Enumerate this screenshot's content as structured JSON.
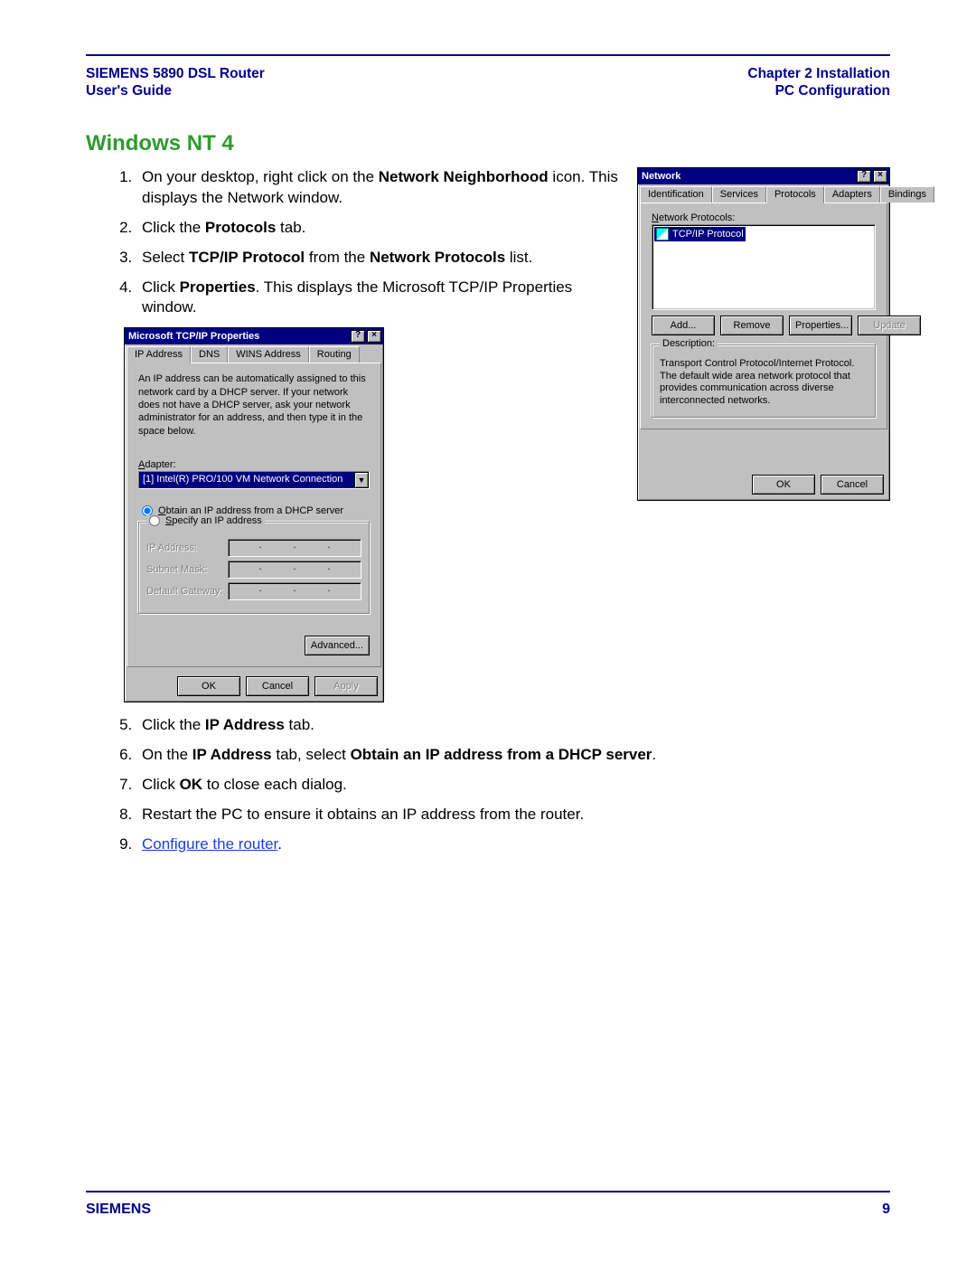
{
  "header": {
    "left1": "SIEMENS 5890 DSL Router",
    "left2": "User's Guide",
    "right1": "Chapter 2  Installation",
    "right2": "PC Configuration"
  },
  "section_title": "Windows NT 4",
  "steps": {
    "s1a": "On your desktop, right click on the ",
    "s1b": "Network Neighborhood",
    "s1c": " icon. This displays the Network window.",
    "s2a": "Click the ",
    "s2b": "Protocols",
    "s2c": " tab.",
    "s3a": " Select ",
    "s3b": "TCP/IP Protocol",
    "s3c": " from the ",
    "s3d": "Network Protocols",
    "s3e": " list.",
    "s4a": " Click ",
    "s4b": "Properties",
    "s4c": ". This displays the Microsoft TCP/IP Properties window.",
    "s5a": "Click the ",
    "s5b": "IP Address",
    "s5c": " tab.",
    "s6a": "On the ",
    "s6b": "IP Address",
    "s6c": " tab, select ",
    "s6d": "Obtain an IP address from a DHCP server",
    "s6e": ".",
    "s7a": "Click ",
    "s7b": "OK",
    "s7c": " to close each dialog.",
    "s8": "Restart the PC to ensure it obtains an IP address from the router.",
    "s9link": "Configure the router",
    "s9dot": "."
  },
  "net_dialog": {
    "title": "Network",
    "help": "?",
    "close": "×",
    "tabs": [
      "Identification",
      "Services",
      "Protocols",
      "Adapters",
      "Bindings"
    ],
    "active_tab_index": 2,
    "list_label": "Network Protocols:",
    "list_item": "TCP/IP Protocol",
    "buttons": {
      "add": "Add...",
      "remove": "Remove",
      "properties": "Properties...",
      "update": "Update"
    },
    "desc_label": "Description:",
    "desc_text": "Transport Control Protocol/Internet Protocol. The default wide area network protocol that provides communication across diverse interconnected networks.",
    "ok": "OK",
    "cancel": "Cancel"
  },
  "tcp_dialog": {
    "title": "Microsoft TCP/IP Properties",
    "help": "?",
    "close": "×",
    "tabs": [
      "IP Address",
      "DNS",
      "WINS Address",
      "Routing"
    ],
    "active_tab_index": 0,
    "note": "An IP address can be automatically assigned to this network card by a DHCP server. If your network does not have a DHCP server, ask your network administrator for an address, and then type it in the space below.",
    "adapter_label": "Adapter:",
    "adapter_value": "[1] Intel(R) PRO/100 VM Network Connection",
    "radio_obtain": "Obtain an IP address from a DHCP server",
    "radio_specify": "Specify an IP address",
    "lbl_ip": "IP Address:",
    "lbl_mask": "Subnet Mask:",
    "lbl_gw": "Default Gateway:",
    "advanced": "Advanced...",
    "ok": "OK",
    "cancel": "Cancel",
    "apply": "Apply"
  },
  "footer": {
    "brand": "SIEMENS",
    "page_number": "9"
  }
}
